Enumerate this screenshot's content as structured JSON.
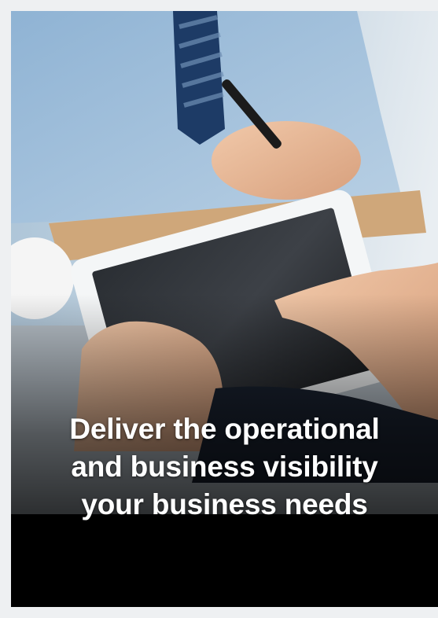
{
  "hero": {
    "image_subject": "business people using a tablet at a desk",
    "headline_lines": [
      "Deliver the operational",
      "and business visibility",
      "your business needs"
    ]
  },
  "colors": {
    "page_background": "#eef0f2",
    "overlay": "#000000",
    "headline_text": "#ffffff"
  }
}
